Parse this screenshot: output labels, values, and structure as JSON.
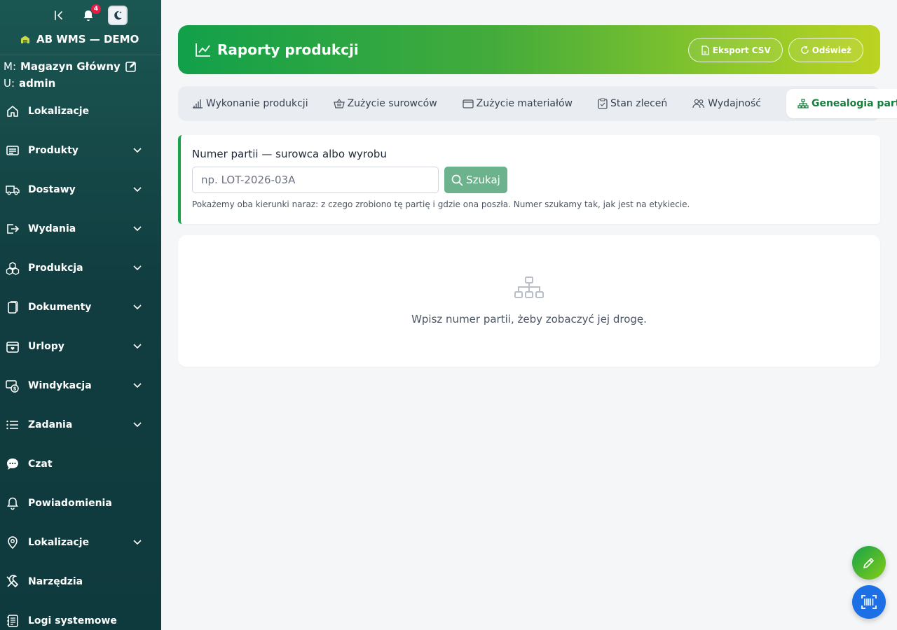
{
  "sidebar": {
    "notifications_count": "4",
    "brand": "AB WMS — DEMO",
    "warehouse_prefix": "M:",
    "warehouse": "Magazyn Główny",
    "user_prefix": "U:",
    "user": "admin",
    "items": [
      {
        "label": "Lokalizacje",
        "icon": "home-icon",
        "expandable": false
      },
      {
        "label": "Produkty",
        "icon": "list-icon",
        "expandable": true
      },
      {
        "label": "Dostawy",
        "icon": "truck-icon",
        "expandable": true
      },
      {
        "label": "Wydania",
        "icon": "exit-icon",
        "expandable": true
      },
      {
        "label": "Produkcja",
        "icon": "boxes-icon",
        "expandable": true
      },
      {
        "label": "Dokumenty",
        "icon": "documents-icon",
        "expandable": true
      },
      {
        "label": "Urlopy",
        "icon": "calendar-heart-icon",
        "expandable": true
      },
      {
        "label": "Windykacja",
        "icon": "cash-icon",
        "expandable": true
      },
      {
        "label": "Zadania",
        "icon": "tasks-icon",
        "expandable": true
      },
      {
        "label": "Czat",
        "icon": "chat-icon",
        "expandable": false
      },
      {
        "label": "Powiadomienia",
        "icon": "bell-icon",
        "expandable": false
      },
      {
        "label": "Lokalizacje",
        "icon": "map-pin-icon",
        "expandable": true
      },
      {
        "label": "Narzędzia",
        "icon": "tools-icon",
        "expandable": false
      },
      {
        "label": "Logi systemowe",
        "icon": "log-icon",
        "expandable": false
      }
    ]
  },
  "header": {
    "title": "Raporty produkcji",
    "export_label": "Eksport CSV",
    "refresh_label": "Odśwież"
  },
  "tabs": [
    {
      "label": "Wykonanie produkcji",
      "icon": "bar-chart-icon"
    },
    {
      "label": "Zużycie surowców",
      "icon": "basket-icon"
    },
    {
      "label": "Zużycie materiałów",
      "icon": "box-icon"
    },
    {
      "label": "Stan zleceń",
      "icon": "clipboard-icon"
    },
    {
      "label": "Wydajność",
      "icon": "people-icon"
    },
    {
      "label": "Genealogia partii",
      "icon": "tree-icon",
      "active": true
    }
  ],
  "search": {
    "label": "Numer partii — surowca albo wyrobu",
    "placeholder": "np. LOT-2026-03A",
    "button_label": "Szukaj",
    "hint": "Pokażemy oba kierunki naraz: z czego zrobiono tę partię i gdzie ona poszła. Numer szukamy tak, jak jest na etykiecie."
  },
  "empty_state": {
    "text": "Wpisz numer partii, żeby zobaczyć jej drogę."
  },
  "colors": {
    "accent": "#16a34a",
    "sidebar": "#113d40",
    "fab_blue": "#1d6fe6"
  }
}
